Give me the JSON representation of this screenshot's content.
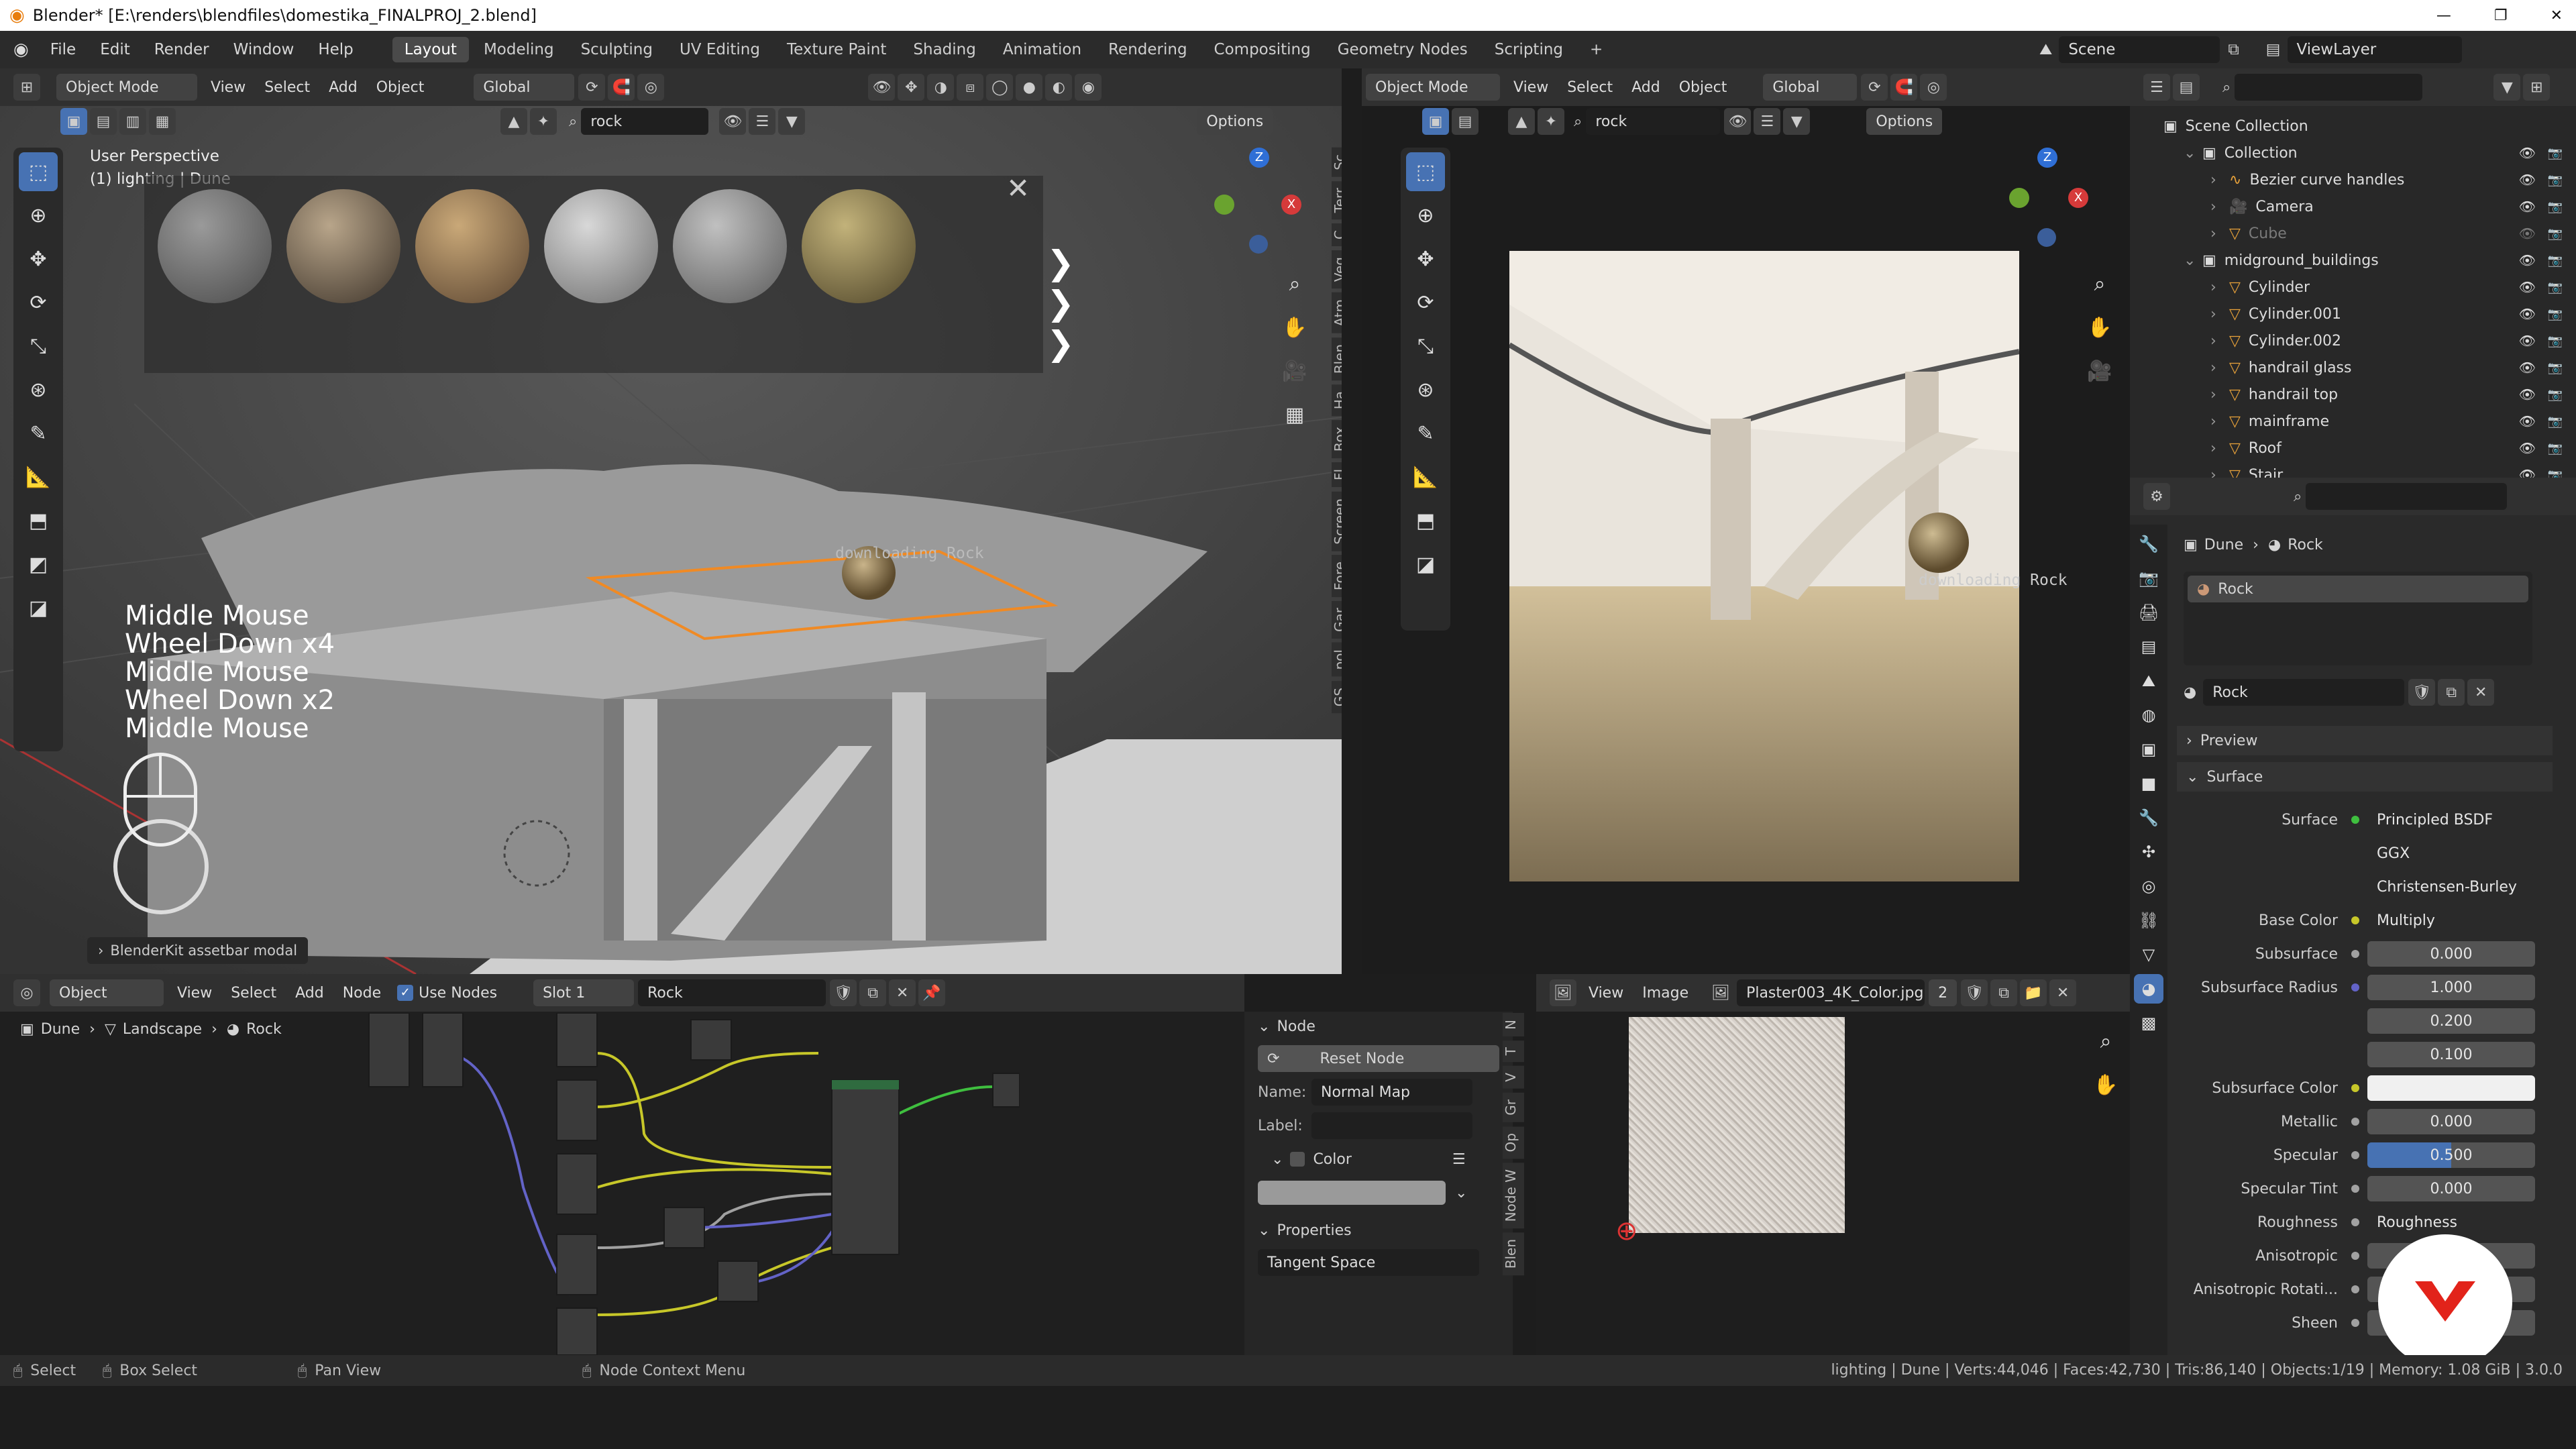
{
  "window": {
    "title": "Blender* [E:\\renders\\blendfiles\\domestika_FINALPROJ_2.blend]",
    "controls": [
      "—",
      "❐",
      "✕"
    ]
  },
  "menu": {
    "items": [
      "File",
      "Edit",
      "Render",
      "Window",
      "Help"
    ],
    "workspaces": [
      "Layout",
      "Modeling",
      "Sculpting",
      "UV Editing",
      "Texture Paint",
      "Shading",
      "Animation",
      "Rendering",
      "Compositing",
      "Geometry Nodes",
      "Scripting"
    ],
    "add_tab": "+",
    "scene": "Scene",
    "view_layer": "ViewLayer"
  },
  "viewport_left": {
    "mode": "Object Mode",
    "menus": [
      "View",
      "Select",
      "Add",
      "Object"
    ],
    "orientation": "Global",
    "search_value": "rock",
    "options": "Options",
    "perspective_label": "User Perspective",
    "collection_label": "(1) lighting | Dune",
    "keystrokes": [
      "Middle Mouse",
      "Wheel Down x4",
      "Middle Mouse",
      "Wheel Down x2",
      "Middle Mouse"
    ],
    "download_label": "downloading Rock",
    "modal_label": "BlenderKit assetbar modal",
    "asset_count": 6,
    "side_tabs": [
      "Sc",
      "Terr",
      "C",
      "Veg",
      "Atm",
      "Blen",
      "Ha",
      "Box",
      "Fl",
      "Screen",
      "Fore",
      "Gar",
      "pol",
      "GS"
    ]
  },
  "viewport_right": {
    "mode": "Object Mode",
    "menus": [
      "View",
      "Select",
      "Add",
      "Object"
    ],
    "orientation": "Global",
    "search_value": "rock",
    "options": "Options",
    "download_label": "downloading Rock"
  },
  "outliner": {
    "search_placeholder": "",
    "root": "Scene Collection",
    "items": [
      {
        "label": "Collection",
        "level": 0,
        "type": "collection"
      },
      {
        "label": "Bezier curve handles",
        "level": 1,
        "type": "curve"
      },
      {
        "label": "Camera",
        "level": 1,
        "type": "camera"
      },
      {
        "label": "Cube",
        "level": 1,
        "type": "mesh",
        "dim": true
      },
      {
        "label": "midground_buildings",
        "level": 0,
        "type": "collection"
      },
      {
        "label": "Cylinder",
        "level": 1,
        "type": "mesh"
      },
      {
        "label": "Cylinder.001",
        "level": 1,
        "type": "mesh"
      },
      {
        "label": "Cylinder.002",
        "level": 1,
        "type": "mesh"
      },
      {
        "label": "handrail glass",
        "level": 1,
        "type": "mesh"
      },
      {
        "label": "handrail top",
        "level": 1,
        "type": "mesh"
      },
      {
        "label": "mainframe",
        "level": 1,
        "type": "mesh"
      },
      {
        "label": "Roof",
        "level": 1,
        "type": "mesh"
      },
      {
        "label": "Stair",
        "level": 1,
        "type": "mesh"
      }
    ]
  },
  "properties": {
    "breadcrumb": [
      "Dune",
      "Rock"
    ],
    "slot_name": "Rock",
    "material_name": "Rock",
    "sections": {
      "preview": "Preview",
      "surface": "Surface"
    },
    "rows": [
      {
        "label": "Surface",
        "value": "Principled BSDF",
        "dot": "#3fbf3f",
        "kind": "link"
      },
      {
        "label": "",
        "value": "GGX",
        "kind": "select"
      },
      {
        "label": "",
        "value": "Christensen-Burley",
        "kind": "select"
      },
      {
        "label": "Base Color",
        "value": "Multiply",
        "dot": "#c7c729",
        "kind": "link"
      },
      {
        "label": "Subsurface",
        "value": "0.000",
        "dot": "#a1a1a1",
        "kind": "num"
      },
      {
        "label": "Subsurface Radius",
        "value": "1.000",
        "dot": "#6363c7",
        "kind": "num"
      },
      {
        "label": "",
        "value": "0.200",
        "kind": "num"
      },
      {
        "label": "",
        "value": "0.100",
        "kind": "num"
      },
      {
        "label": "Subsurface Color",
        "value": "",
        "dot": "#c7c729",
        "kind": "color"
      },
      {
        "label": "Metallic",
        "value": "0.000",
        "dot": "#a1a1a1",
        "kind": "num"
      },
      {
        "label": "Specular",
        "value": "0.500",
        "dot": "#a1a1a1",
        "kind": "slider"
      },
      {
        "label": "Specular Tint",
        "value": "0.000",
        "dot": "#a1a1a1",
        "kind": "num"
      },
      {
        "label": "Roughness",
        "value": "Roughness",
        "dot": "#a1a1a1",
        "kind": "link"
      },
      {
        "label": "Anisotropic",
        "value": "0.000",
        "dot": "#a1a1a1",
        "kind": "num"
      },
      {
        "label": "Anisotropic Rotati...",
        "value": "",
        "dot": "#a1a1a1",
        "kind": "num"
      },
      {
        "label": "Sheen",
        "value": "",
        "dot": "#a1a1a1",
        "kind": "num"
      }
    ],
    "specular_fill": 0.5
  },
  "node_editor": {
    "object_label": "Object",
    "menus": [
      "View",
      "Select",
      "Add",
      "Node"
    ],
    "use_nodes": "Use Nodes",
    "slot": "Slot 1",
    "material": "Rock",
    "breadcrumb": [
      "Dune",
      "Landscape",
      "Rock"
    ]
  },
  "node_panel": {
    "section": "Node",
    "reset": "Reset Node",
    "name_label": "Name:",
    "name_value": "Normal Map",
    "label_label": "Label:",
    "label_value": "",
    "color_label": "Color",
    "properties_label": "Properties",
    "space": "Tangent Space",
    "tabs": [
      "N",
      "T",
      "V",
      "Gr",
      "Op",
      "Node W",
      "Blen"
    ]
  },
  "image_editor": {
    "menus": [
      "View",
      "Image"
    ],
    "image_name": "Plaster003_4K_Color.jpg",
    "users": "2"
  },
  "statusbar": {
    "items": [
      "Select",
      "Box Select",
      "Pan View",
      "Node Context Menu"
    ],
    "stats": "lighting | Dune | Verts:44,046 | Faces:42,730 | Tris:86,140 | Objects:1/19 | Memory: 1.08 GiB | 3.0.0"
  },
  "colors": {
    "accent": "#4772b3",
    "brand": "#e2231a",
    "highlight_orange": "#f08a24"
  }
}
